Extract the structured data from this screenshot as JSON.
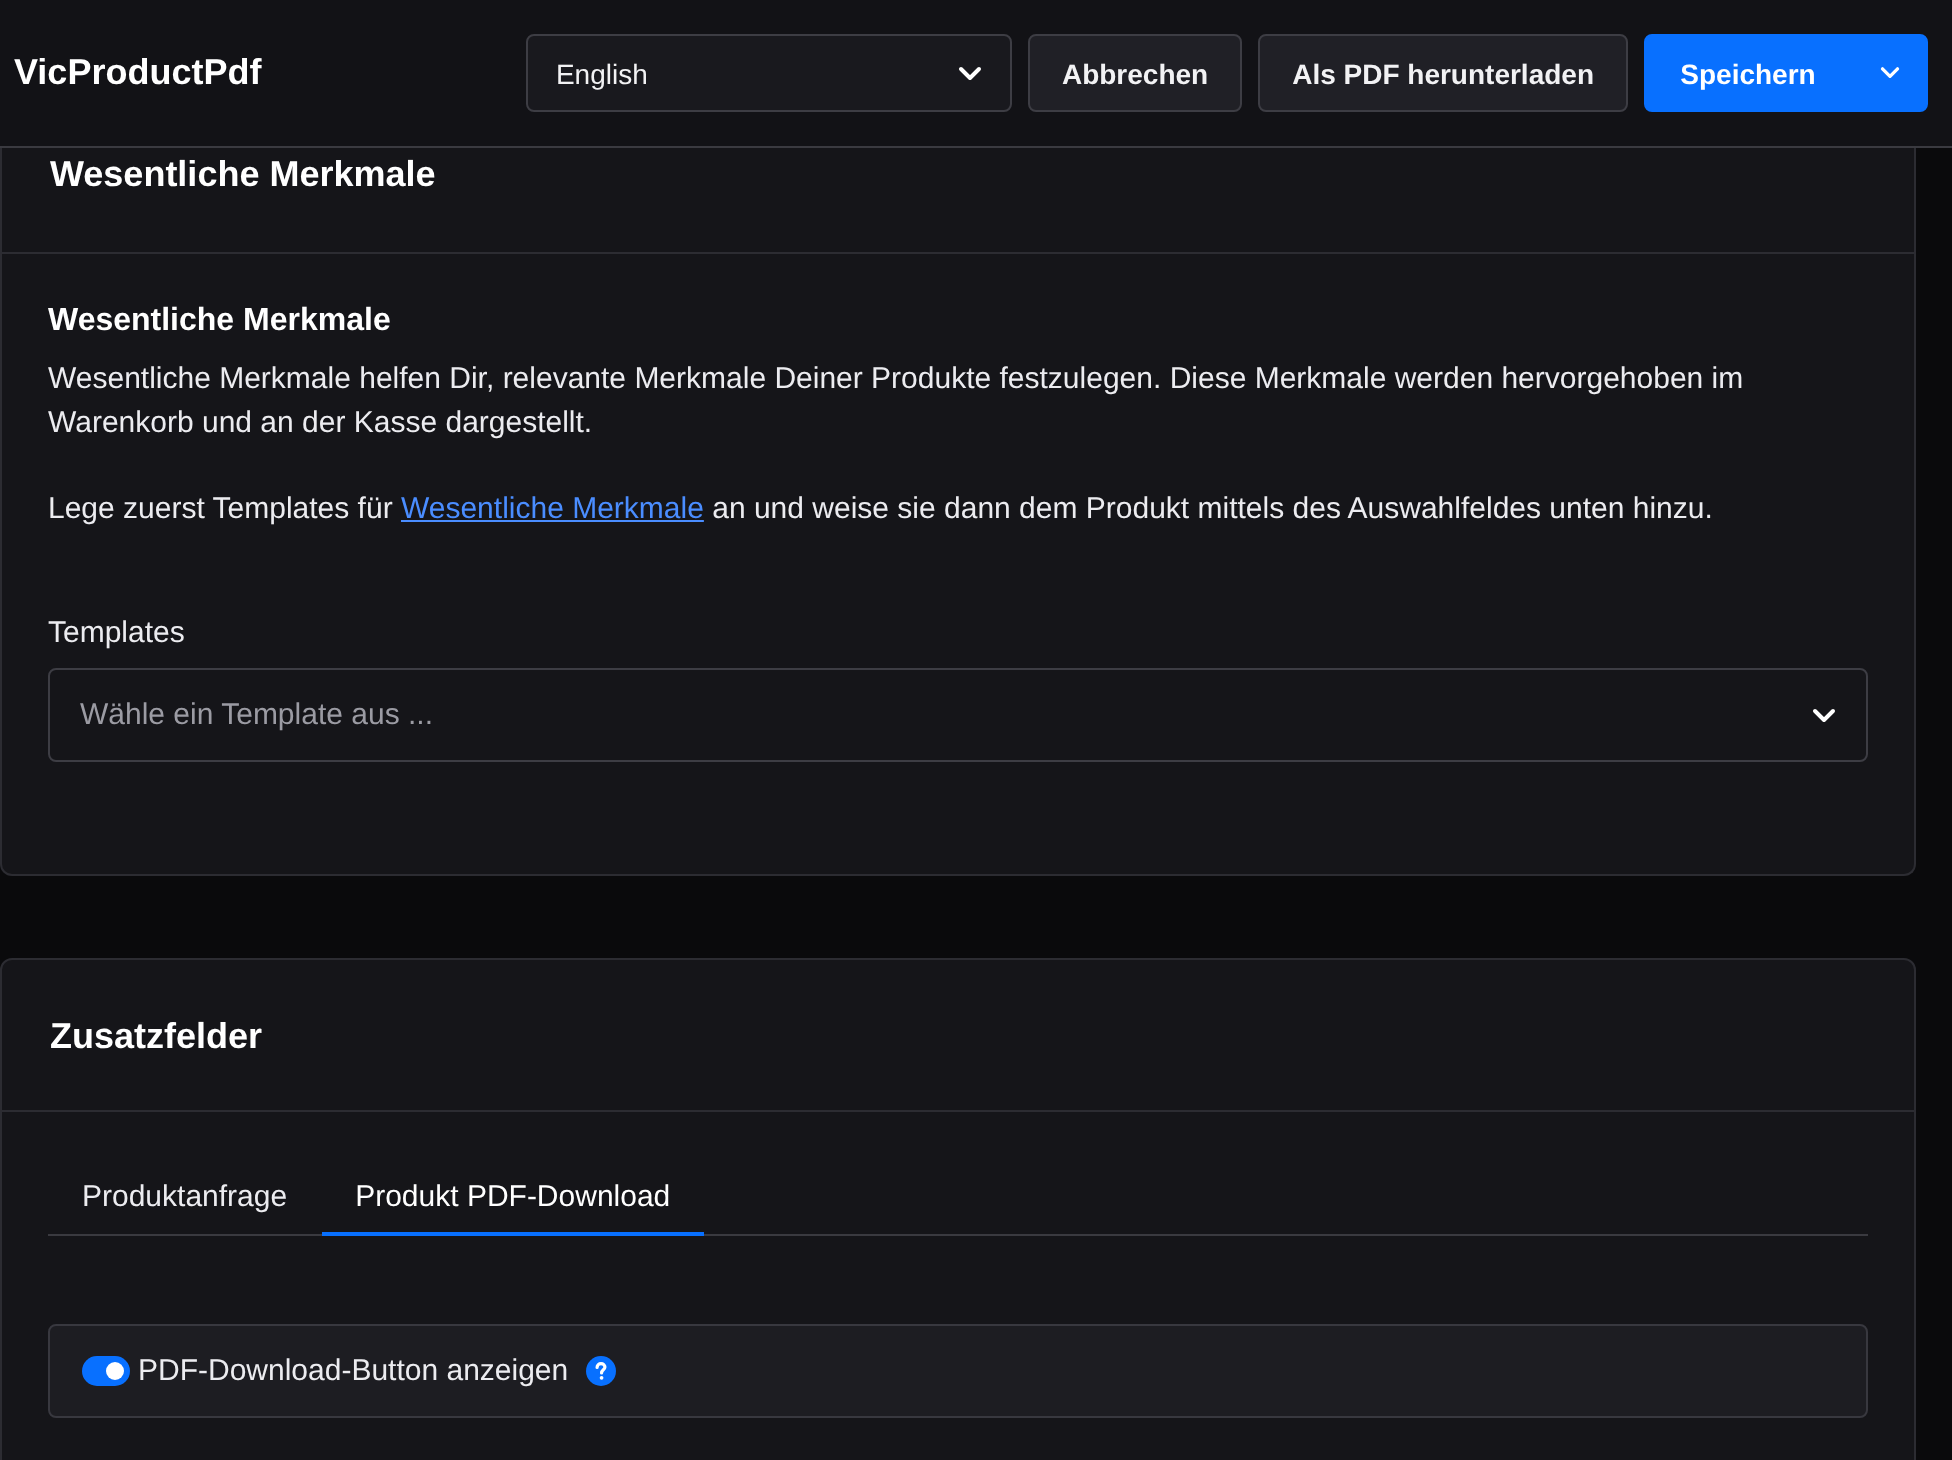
{
  "header": {
    "title": "VicProductPdf",
    "language_select": {
      "value": "English"
    },
    "buttons": [
      {
        "kind": "secondary",
        "label": "Abbrechen"
      },
      {
        "kind": "secondary",
        "label": "Als PDF herunterladen"
      },
      {
        "kind": "split",
        "label": "Speichern"
      }
    ]
  },
  "essential_features_card": {
    "title": "Wesentliche Merkmale",
    "heading": "Wesentliche Merkmale",
    "description": "Wesentliche Merkmale helfen Dir, relevante Merkmale Deiner Produkte festzulegen. Diese Merkmale werden hervorgehoben im Warenkorb und an der Kasse dargestellt.",
    "instruction": {
      "before": "Lege zuerst Templates für",
      "link": "Wesentliche Merkmale",
      "after": "an und weise sie dann dem Produkt mittels des Auswahlfeldes unten hinzu."
    },
    "templates_field": {
      "label": "Templates",
      "placeholder": "Wähle ein Template aus ..."
    }
  },
  "additional_fields_card": {
    "title": "Zusatzfelder",
    "tabs": [
      {
        "label": "Produktanfrage",
        "selected": false
      },
      {
        "label": "Produkt PDF-Download",
        "selected": true
      }
    ],
    "settings": [
      {
        "kind": "toggle",
        "label": "PDF-Download-Button anzeigen",
        "on": true,
        "help": true
      }
    ]
  }
}
